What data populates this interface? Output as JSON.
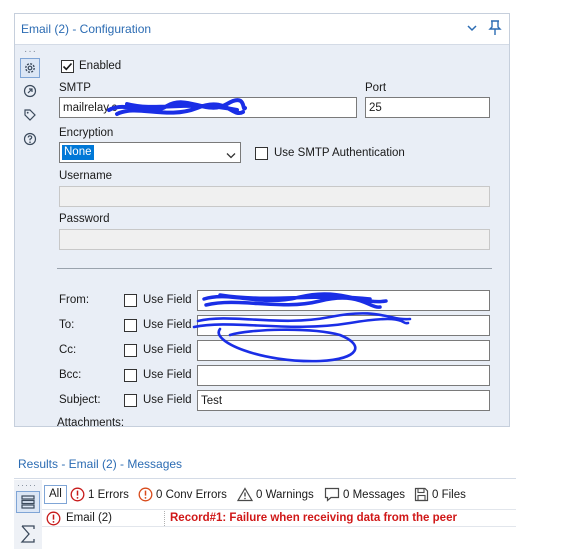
{
  "config": {
    "title": "Email (2) - Configuration",
    "enabled_label": "Enabled",
    "enabled_checked": true,
    "smtp_label": "SMTP",
    "smtp_value": "mailrelay.c",
    "port_label": "Port",
    "port_value": "25",
    "encryption_label": "Encryption",
    "encryption_value": "None",
    "use_smtp_auth_label": "Use SMTP Authentication",
    "username_label": "Username",
    "username_value": "",
    "password_label": "Password",
    "password_value": "",
    "fields": {
      "from_label": "From:",
      "to_label": "To:",
      "cc_label": "Cc:",
      "bcc_label": "Bcc:",
      "subject_label": "Subject:",
      "use_field_label": "Use Field",
      "from_value": "",
      "to_value": "",
      "cc_value": "",
      "bcc_value": "",
      "subject_value": "Test"
    },
    "attachments_label": "Attachments:"
  },
  "results": {
    "title": "Results - Email (2) - Messages",
    "filters": {
      "all": "All",
      "errors": "1 Errors",
      "conv_errors": "0 Conv Errors",
      "warnings": "0 Warnings",
      "messages": "0 Messages",
      "files": "0 Files"
    },
    "rows": [
      {
        "tool": "Email (2)",
        "message": "Record#1: Failure when receiving data from the peer"
      }
    ]
  },
  "colors": {
    "accent": "#2c6cb3",
    "error": "#d01818",
    "scribble": "#1a2ee6"
  }
}
